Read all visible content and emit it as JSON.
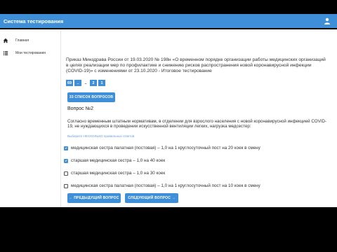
{
  "header": {
    "title": "Система тестирования",
    "user_icon": "user-icon"
  },
  "sidebar": {
    "items": [
      {
        "label": "Главная",
        "icon": "home-icon"
      },
      {
        "label": "Мои тестирования",
        "icon": "list-icon"
      }
    ]
  },
  "main": {
    "prikaz_text": "Приказ Минздрава России от 19.03.2020 № 198н «О временном порядке организации работы медицинских организаций в целях реализации мер по профилактике и снижению рисков распространения новой коронавирусной инфекции (COVID-19)» с изменениями от 23.10.2020 - Итоговое тестирование",
    "question_nav": [
      "69",
      "..",
      "2",
      "1"
    ],
    "questions_list_button": "33 СПИСОК ВОПРОСОВ",
    "question_title": "Вопрос №2",
    "question_text": "Согласно временным штатным нормативам, в отделении для взрослого населения с новой коронавирусной инфекцией COVID-19, не нуждающихся в проведении искусственной вентиляции легких, нагрузка медсестер:",
    "hint": "Выберите НЕСКОЛЬКО правильных ответов",
    "options": [
      {
        "label": "медицинская сестра палатная (постовая) – 1,0 на 1 круглосуточный пост на 20 коек в смену",
        "checked": true
      },
      {
        "label": "старшая медицинская сестра – 1,0 на 40 коек",
        "checked": true
      },
      {
        "label": "старшая медицинская сестра – 1,0 на 30 коек",
        "checked": false
      },
      {
        "label": "медицинская сестра палатная (постовая) – 1,0 на 1 круглосуточный пост на 10 коек в смену",
        "checked": false
      }
    ],
    "prev_button": "← ПРЕДЫДУЩИЙ ВОПРОС",
    "next_button": "СЛЕДУЮЩИЙ ВОПРОС →"
  },
  "colors": {
    "accent": "#3f8fd8",
    "letterbox": "#000000",
    "hint": "#6aa0d8"
  }
}
